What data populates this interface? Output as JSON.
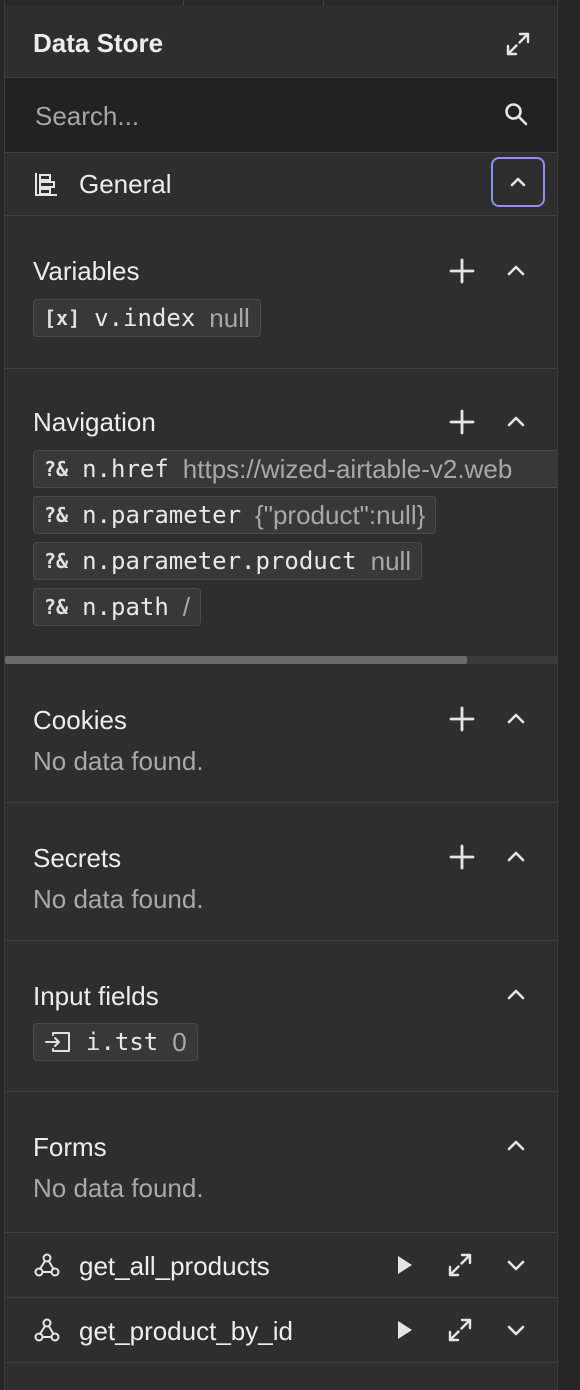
{
  "header": {
    "title": "Data Store"
  },
  "search": {
    "placeholder": "Search..."
  },
  "general": {
    "label": "General"
  },
  "variables": {
    "title": "Variables",
    "items": [
      {
        "icon": "[x]",
        "key": "v.index",
        "value": "null"
      }
    ]
  },
  "navigation": {
    "title": "Navigation",
    "items": [
      {
        "icon": "?&",
        "key": "n.href",
        "value": "https://wized-airtable-v2.web"
      },
      {
        "icon": "?&",
        "key": "n.parameter",
        "value": "{\"product\":null}"
      },
      {
        "icon": "?&",
        "key": "n.parameter.product",
        "value": "null"
      },
      {
        "icon": "?&",
        "key": "n.path",
        "value": "/"
      }
    ]
  },
  "cookies": {
    "title": "Cookies",
    "empty": "No data found."
  },
  "secrets": {
    "title": "Secrets",
    "empty": "No data found."
  },
  "inputs": {
    "title": "Input fields",
    "items": [
      {
        "key": "i.tst",
        "value": "0"
      }
    ]
  },
  "forms": {
    "title": "Forms",
    "empty": "No data found."
  },
  "requests": [
    {
      "label": "get_all_products"
    },
    {
      "label": "get_product_by_id"
    }
  ],
  "colors": {
    "focus_ring": "#8f8ff0",
    "panel_bg": "#2e2e2e",
    "chip_bg": "#383838"
  }
}
